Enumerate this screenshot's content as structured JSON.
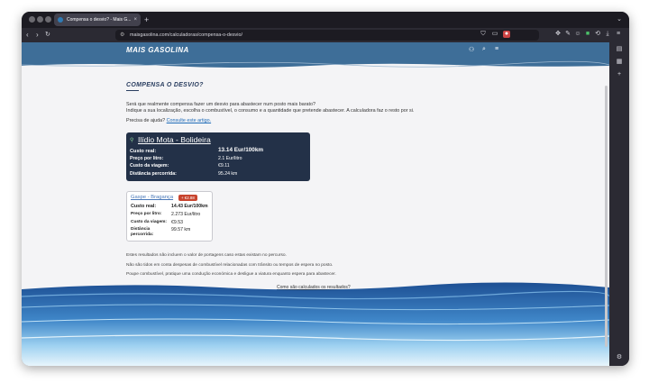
{
  "browser": {
    "tab_title": "Compensa o desvio? - Mais G...",
    "tab_close": "×",
    "new_tab": "+",
    "url": "maisgasolina.com/calculadoras/compensa-o-desvio/"
  },
  "site": {
    "logo": "MAIS GASOLINA"
  },
  "page": {
    "title": "COMPENSA O DESVIO?",
    "intro_line1": "Será que realmente compensa fazer um desvio para abastecer num posto mais barato?",
    "intro_line2": "Indique a sua localização, escolha o combustível, o consumo e a quantidade que pretende abastecer. A calculadora faz o resto por si.",
    "help_prefix": "Precisa de ajuda?",
    "help_link": "Consulte este artigo."
  },
  "best_result": {
    "name": "Ilídio Mota - Bolideira",
    "rows": [
      {
        "label": "Custo real:",
        "value": "13.14 Eur/100km"
      },
      {
        "label": "Preço por litro:",
        "value": "2.1 Eur/litro"
      },
      {
        "label": "Custo da viagem:",
        "value": "€9.11"
      },
      {
        "label": "Distância percorrida:",
        "value": "95.24 km"
      }
    ]
  },
  "other_result": {
    "name": "Gaspe - Bragança",
    "badge": "+ €2.88",
    "rows": [
      {
        "label": "Custo real:",
        "value": "14.43 Eur/100km"
      },
      {
        "label": "Preço por litro:",
        "value": "2.273 Eur/litro"
      },
      {
        "label": "Custo da viagem:",
        "value": "€9.53"
      },
      {
        "label": "Distância percorrida:",
        "value": "99.57 km"
      }
    ]
  },
  "notes": [
    "Estes resultados não incluem o valor de portagens caso estas existam no percurso.",
    "Não são tidos em conta despesas de combustível relacionadas com trânsito ou tempos de espera no posto.",
    "Poupe combustível, pratique uma condução económica e desligue a viatura enquanto espera para abastecer."
  ],
  "how_link": "Como são calculados os resultados?",
  "colors": {
    "brand_blue": "#3e6e98",
    "card_dark": "#233148",
    "badge_red": "#c8442e"
  }
}
